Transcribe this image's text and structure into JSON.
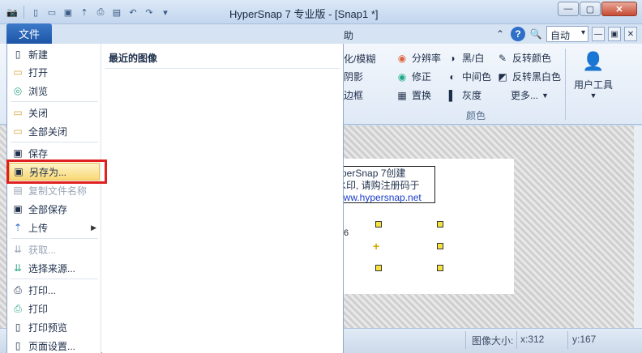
{
  "window": {
    "title": "HyperSnap 7 专业版 - [Snap1 *]"
  },
  "qat": [
    {
      "icon": "camera-icon"
    },
    {
      "icon": "new-doc-icon"
    },
    {
      "icon": "open-folder-icon"
    },
    {
      "icon": "save-icon"
    },
    {
      "icon": "upload-icon"
    },
    {
      "icon": "print-icon"
    },
    {
      "icon": "clipboard-icon"
    },
    {
      "icon": "undo-icon"
    },
    {
      "icon": "redo-icon"
    }
  ],
  "ribbon": {
    "help_tab": "助",
    "zoom": "自动",
    "items": {
      "blur": "化/模糊",
      "shadow": "阴影",
      "frame": "边框",
      "resolution": "分辨率",
      "correct": "修正",
      "replace": "置换",
      "bw": "黑/白",
      "midtone": "中间色",
      "gray": "灰度",
      "invert": "反转颜色",
      "invert_bw": "反转黑白色",
      "more": "更多..."
    },
    "group_color": "颜色",
    "user_tools": "用户工具"
  },
  "file_menu": {
    "tab": "文件",
    "items": [
      {
        "label": "新建",
        "icon": "new-doc-icon"
      },
      {
        "label": "打开",
        "icon": "open-folder-icon"
      },
      {
        "label": "浏览",
        "icon": "browse-icon"
      },
      {
        "label": "关闭",
        "icon": "close-folder-icon"
      },
      {
        "label": "全部关闭",
        "icon": "close-all-icon"
      },
      {
        "label": "保存",
        "icon": "save-icon"
      },
      {
        "label": "另存为...",
        "icon": "save-as-icon"
      },
      {
        "label": "复制文件名称",
        "icon": "copy-filename-icon"
      },
      {
        "label": "全部保存",
        "icon": "save-all-icon"
      },
      {
        "label": "上传",
        "icon": "upload-icon"
      },
      {
        "label": "获取...",
        "icon": "acquire-icon"
      },
      {
        "label": "选择来源...",
        "icon": "select-source-icon"
      },
      {
        "label": "打印...",
        "icon": "print-icon"
      },
      {
        "label": "打印",
        "icon": "print-quick-icon"
      },
      {
        "label": "打印预览",
        "icon": "print-preview-icon"
      },
      {
        "label": "页面设置...",
        "icon": "page-setup-icon"
      }
    ],
    "recent_title": "最近的图像"
  },
  "canvas": {
    "watermark_line1": "yperSnap 7创建",
    "watermark_line2": "水印, 请购注册码于",
    "watermark_url": "www.hypersnap.net",
    "six": "6"
  },
  "status": {
    "size_label": "图像大小:",
    "x": "x:312",
    "y": "y:167"
  }
}
